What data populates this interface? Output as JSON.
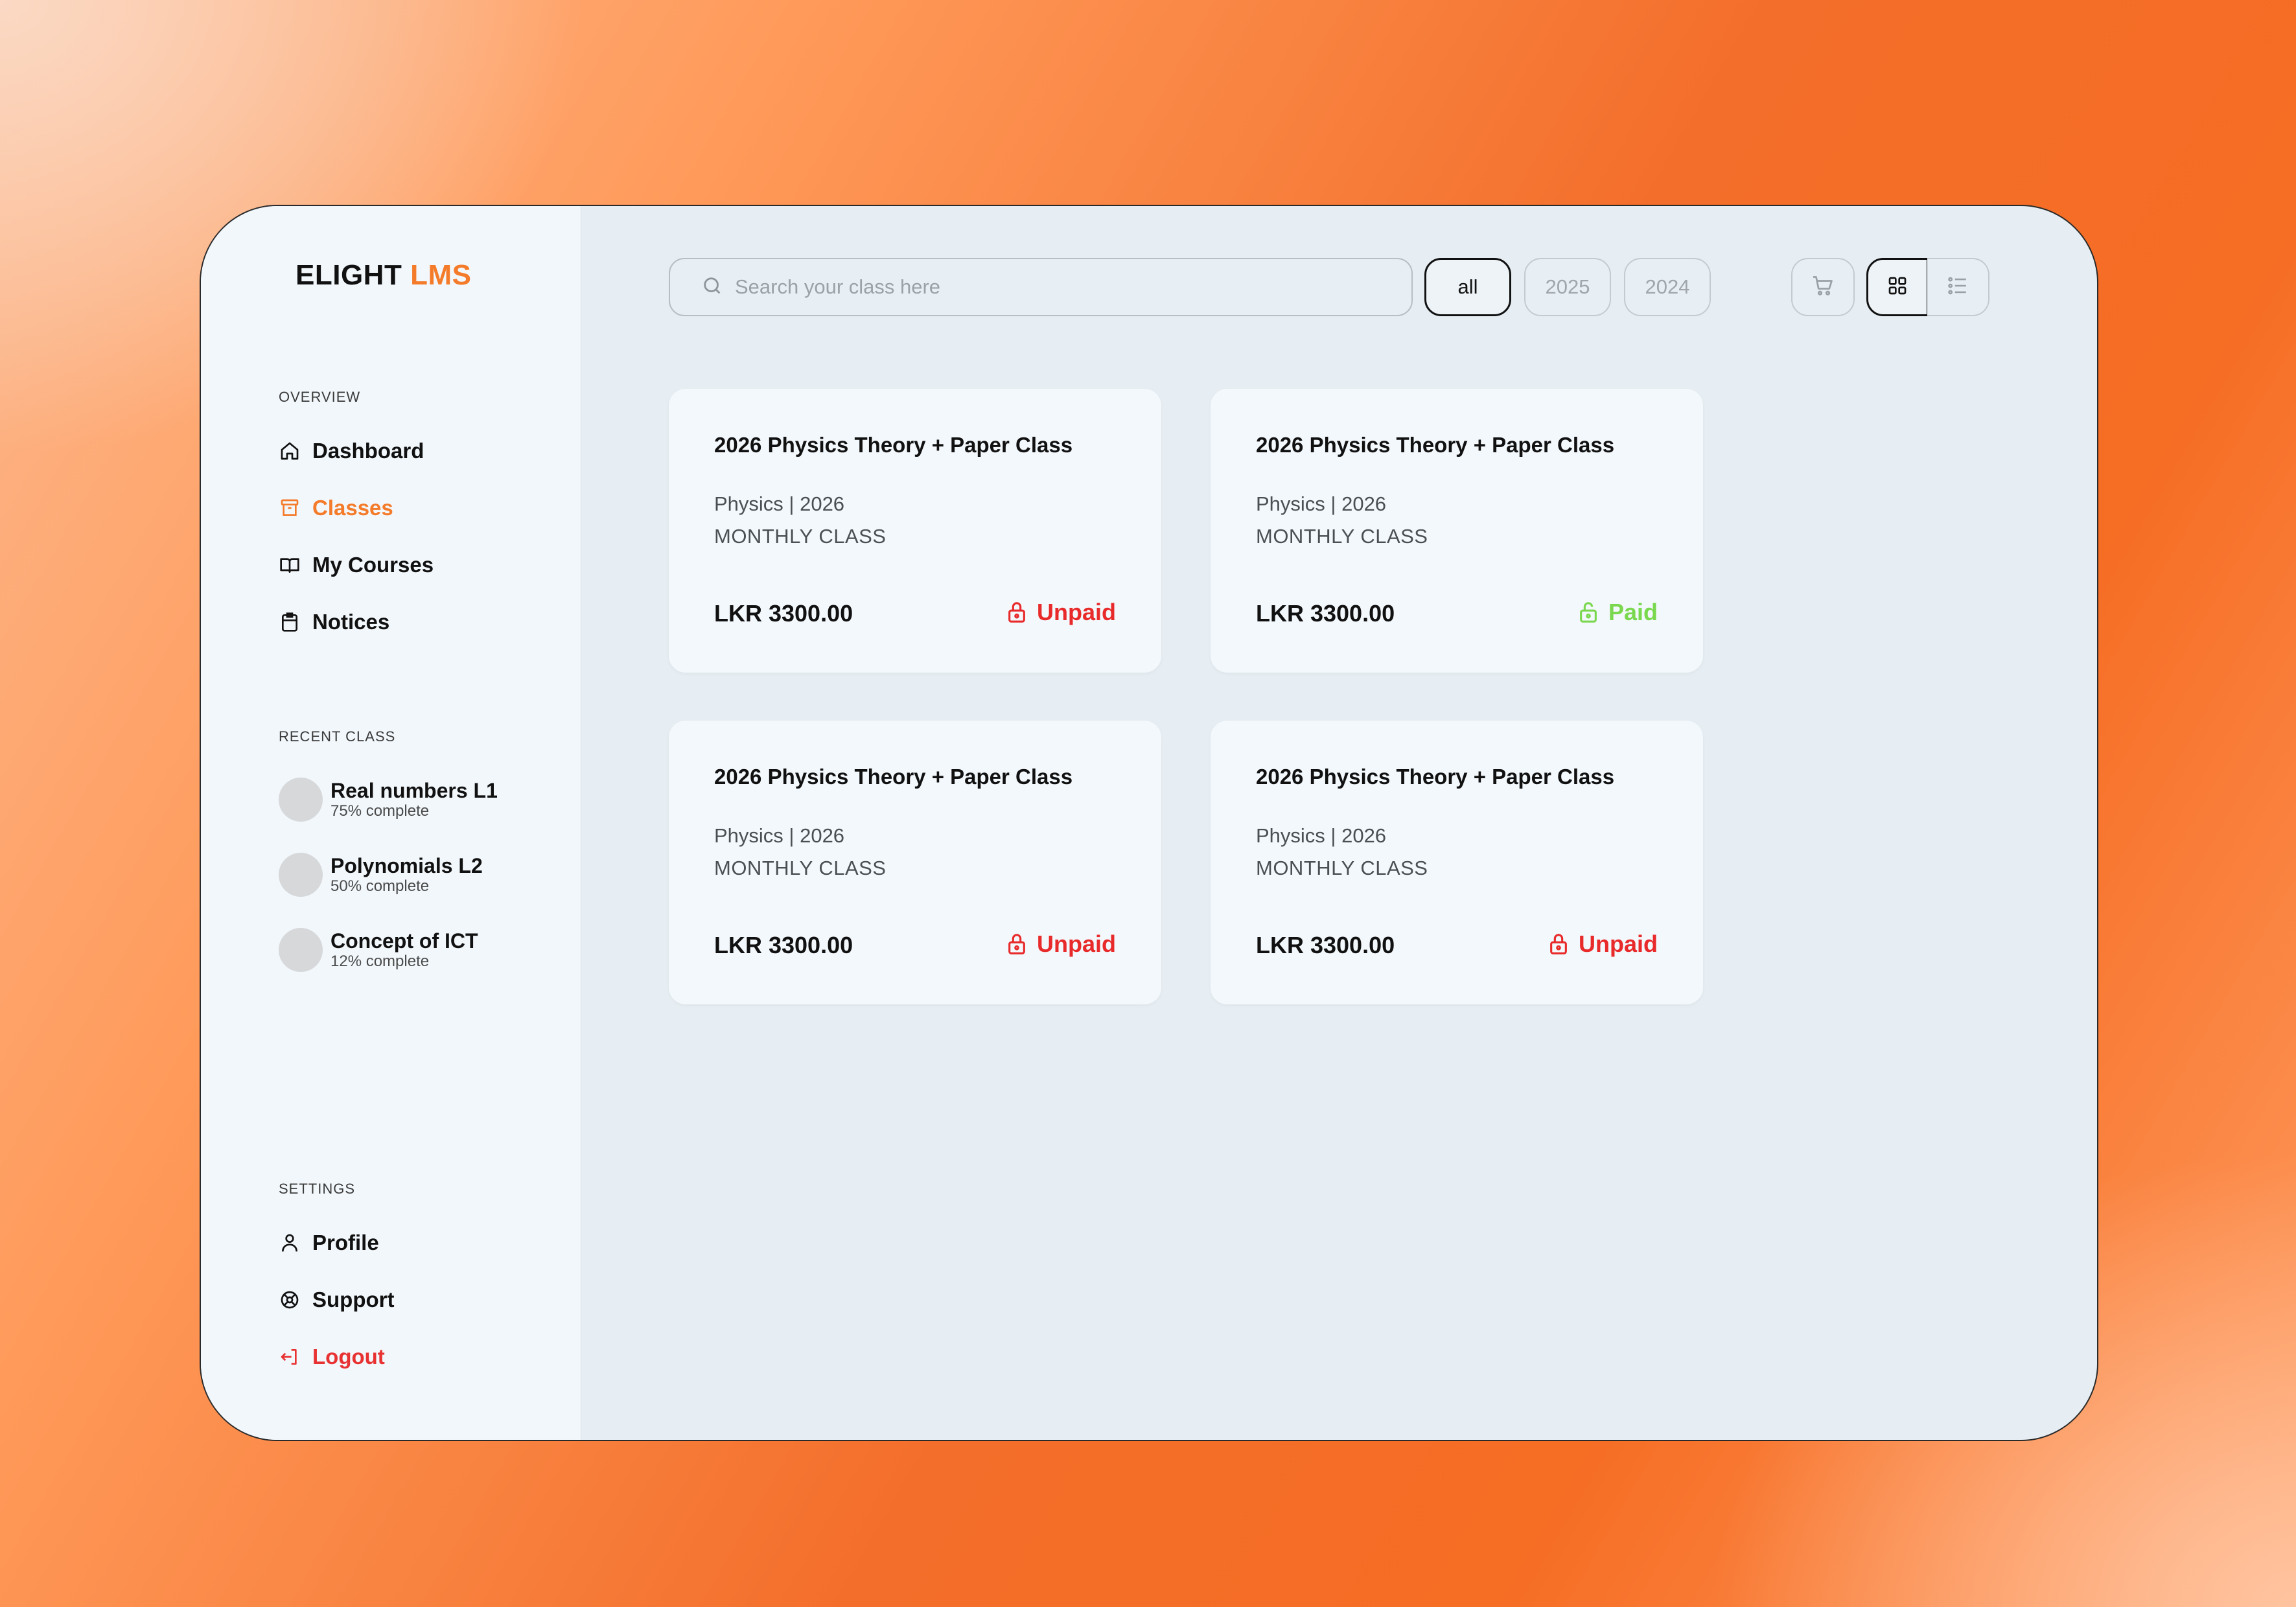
{
  "brand": {
    "name_main": "ELIGHT",
    "name_accent": "LMS"
  },
  "sidebar": {
    "overview_label": "OVERVIEW",
    "nav": [
      {
        "label": "Dashboard",
        "icon": "home-icon"
      },
      {
        "label": "Classes",
        "icon": "archive-icon"
      },
      {
        "label": "My Courses",
        "icon": "book-icon"
      },
      {
        "label": "Notices",
        "icon": "clipboard-icon"
      }
    ],
    "recent_label": "RECENT CLASS",
    "recent": [
      {
        "title": "Real numbers L1",
        "progress": "75% complete"
      },
      {
        "title": "Polynomials L2",
        "progress": "50% complete"
      },
      {
        "title": "Concept of ICT",
        "progress": "12% complete"
      }
    ],
    "settings_label": "SETTINGS",
    "settings": [
      {
        "label": "Profile",
        "icon": "user-icon"
      },
      {
        "label": "Support",
        "icon": "support-icon"
      },
      {
        "label": "Logout",
        "icon": "logout-icon"
      }
    ]
  },
  "toolbar": {
    "search_placeholder": "Search your class here",
    "filters": [
      "all",
      "2025",
      "2024"
    ],
    "selected_filter": "all",
    "view_mode": "grid"
  },
  "cards": [
    {
      "title": "2026 Physics Theory + Paper Class",
      "meta": "Physics | 2026",
      "type": "MONTHLY CLASS",
      "price": "LKR 3300.00",
      "status": "Unpaid"
    },
    {
      "title": "2026 Physics Theory + Paper Class",
      "meta": "Physics | 2026",
      "type": "MONTHLY CLASS",
      "price": "LKR 3300.00",
      "status": "Paid"
    },
    {
      "title": "2026 Physics Theory + Paper Class",
      "meta": "Physics | 2026",
      "type": "MONTHLY CLASS",
      "price": "LKR 3300.00",
      "status": "Unpaid"
    },
    {
      "title": "2026 Physics Theory + Paper Class",
      "meta": "Physics | 2026",
      "type": "MONTHLY CLASS",
      "price": "LKR 3300.00",
      "status": "Unpaid"
    }
  ],
  "colors": {
    "accent": "#f47b2a",
    "unpaid": "#e82a2a",
    "paid": "#7ad84e"
  }
}
